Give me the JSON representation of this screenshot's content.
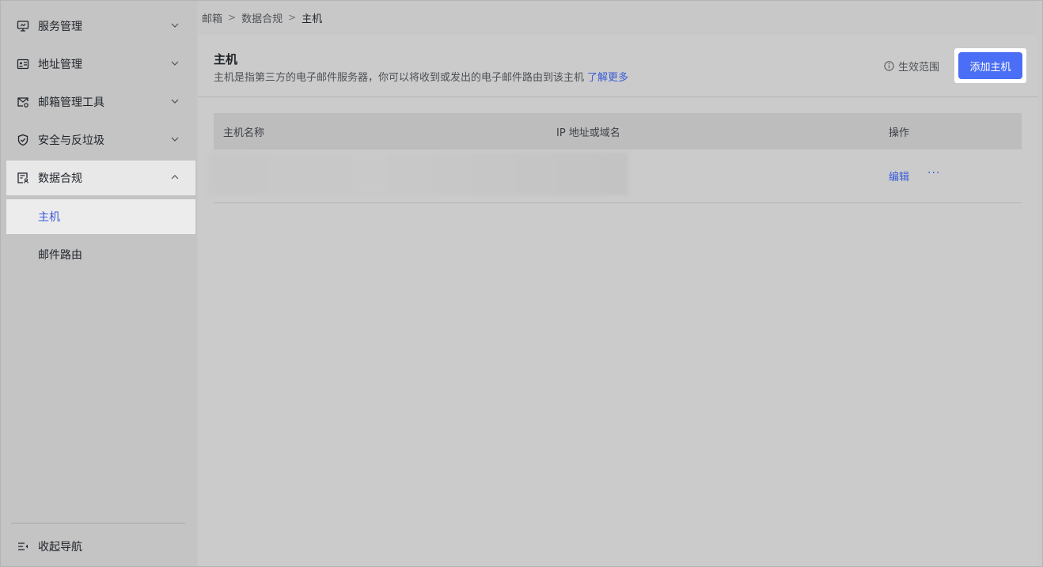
{
  "sidebar": {
    "items": [
      {
        "label": "服务管理",
        "icon": "monitor-icon",
        "expanded": false
      },
      {
        "label": "地址管理",
        "icon": "contact-card-icon",
        "expanded": false
      },
      {
        "label": "邮箱管理工具",
        "icon": "mail-settings-icon",
        "expanded": false
      },
      {
        "label": "安全与反垃圾",
        "icon": "shield-check-icon",
        "expanded": false
      },
      {
        "label": "数据合规",
        "icon": "document-user-icon",
        "expanded": true
      }
    ],
    "sub_items": [
      {
        "label": "主机",
        "selected": true
      },
      {
        "label": "邮件路由",
        "selected": false
      }
    ],
    "collapse_label": "收起导航"
  },
  "breadcrumb": {
    "items": [
      "邮箱",
      "数据合规",
      "主机"
    ],
    "separator": ">"
  },
  "header": {
    "title": "主机",
    "description": "主机是指第三方的电子邮件服务器，你可以将收到或发出的电子邮件路由到该主机",
    "learn_more": "了解更多",
    "scope_label": "生效范围",
    "add_button": "添加主机"
  },
  "table": {
    "columns": [
      "主机名称",
      "IP 地址或域名",
      "操作"
    ],
    "rows": [
      {
        "name": "",
        "address": "",
        "actions": {
          "edit": "编辑",
          "more": "···"
        }
      }
    ]
  },
  "colors": {
    "accent": "#4a6ef5",
    "link": "#3a5bd9",
    "overlay_background": "#c8c8c8"
  }
}
